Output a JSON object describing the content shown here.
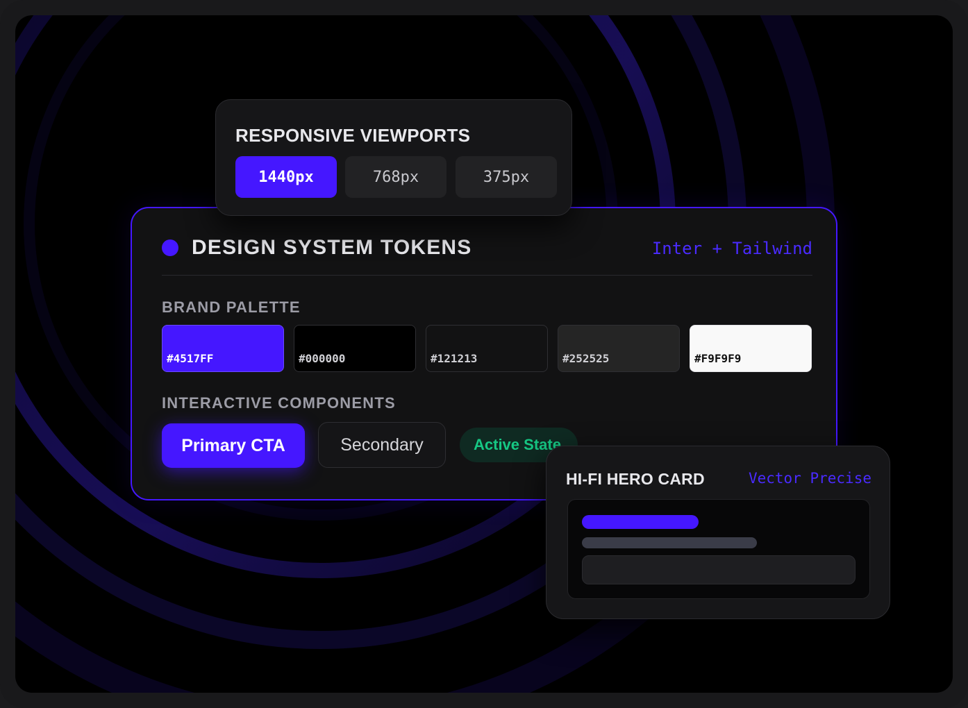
{
  "viewports": {
    "title": "RESPONSIVE VIEWPORTS",
    "options": [
      "1440px",
      "768px",
      "375px"
    ],
    "selected": "1440px"
  },
  "tokens": {
    "title": "DESIGN SYSTEM TOKENS",
    "font_stack": "Inter + Tailwind",
    "palette_label": "BRAND PALETTE",
    "palette": [
      {
        "hex": "#4517FF"
      },
      {
        "hex": "#000000"
      },
      {
        "hex": "#121213"
      },
      {
        "hex": "#252525"
      },
      {
        "hex": "#F9F9F9"
      }
    ],
    "components_label": "INTERACTIVE COMPONENTS",
    "primary_label": "Primary CTA",
    "secondary_label": "Secondary",
    "active_label": "Active State"
  },
  "hero": {
    "title": "HI-FI HERO CARD",
    "tag": "Vector Precise"
  },
  "colors": {
    "accent": "#4517FF",
    "success": "#16C784",
    "surface": "#121213"
  }
}
